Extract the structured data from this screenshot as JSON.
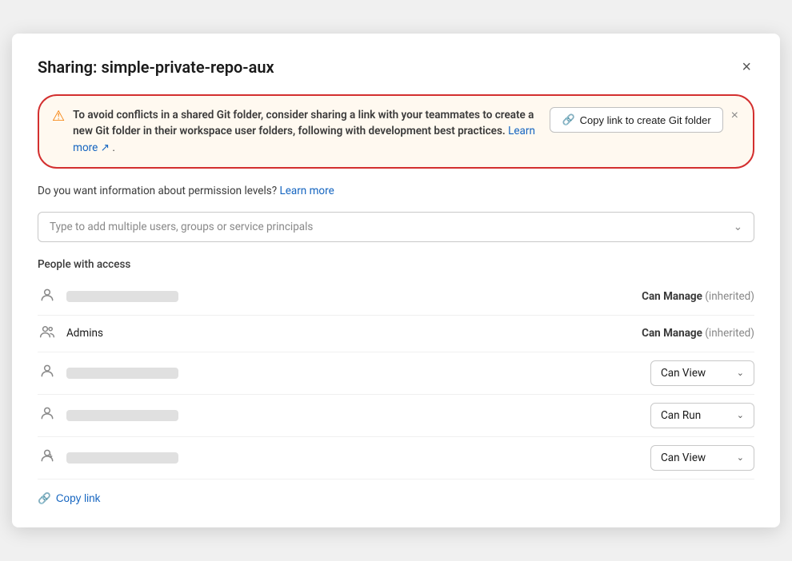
{
  "modal": {
    "title": "Sharing: simple-private-repo-aux",
    "close_label": "×"
  },
  "warning_banner": {
    "icon": "⚠",
    "text_bold": "To avoid conflicts in a shared Git folder, consider sharing a link with your teammates to create a new Git folder in their workspace user folders, following with development best practices.",
    "learn_more_label": "Learn more",
    "learn_more_icon": "↗",
    "copy_git_btn_icon": "🔗",
    "copy_git_btn_label": "Copy link to create Git folder",
    "close_icon": "×"
  },
  "permission_info": {
    "text": "Do you want information about permission levels?",
    "learn_more_label": "Learn more"
  },
  "search": {
    "placeholder": "Type to add multiple users, groups or service principals",
    "chevron": "⌄"
  },
  "people_section": {
    "label": "People with access",
    "people": [
      {
        "icon_type": "person",
        "name_blurred": true,
        "name": "",
        "permission": "Can Manage",
        "inherited": true
      },
      {
        "icon_type": "group",
        "name_blurred": false,
        "name": "Admins",
        "permission": "Can Manage",
        "inherited": true
      },
      {
        "icon_type": "person",
        "name_blurred": true,
        "name": "",
        "permission": "Can View",
        "inherited": false
      },
      {
        "icon_type": "person",
        "name_blurred": true,
        "name": "",
        "permission": "Can Run",
        "inherited": false
      },
      {
        "icon_type": "person-link",
        "name_blurred": true,
        "name": "",
        "permission": "Can View",
        "inherited": false
      }
    ]
  },
  "footer": {
    "copy_link_icon": "🔗",
    "copy_link_label": "Copy link"
  },
  "colors": {
    "accent": "#1565c0",
    "warning_border": "#d32f2f",
    "warning_bg": "#fff9f0",
    "warning_icon": "#f57c00"
  }
}
